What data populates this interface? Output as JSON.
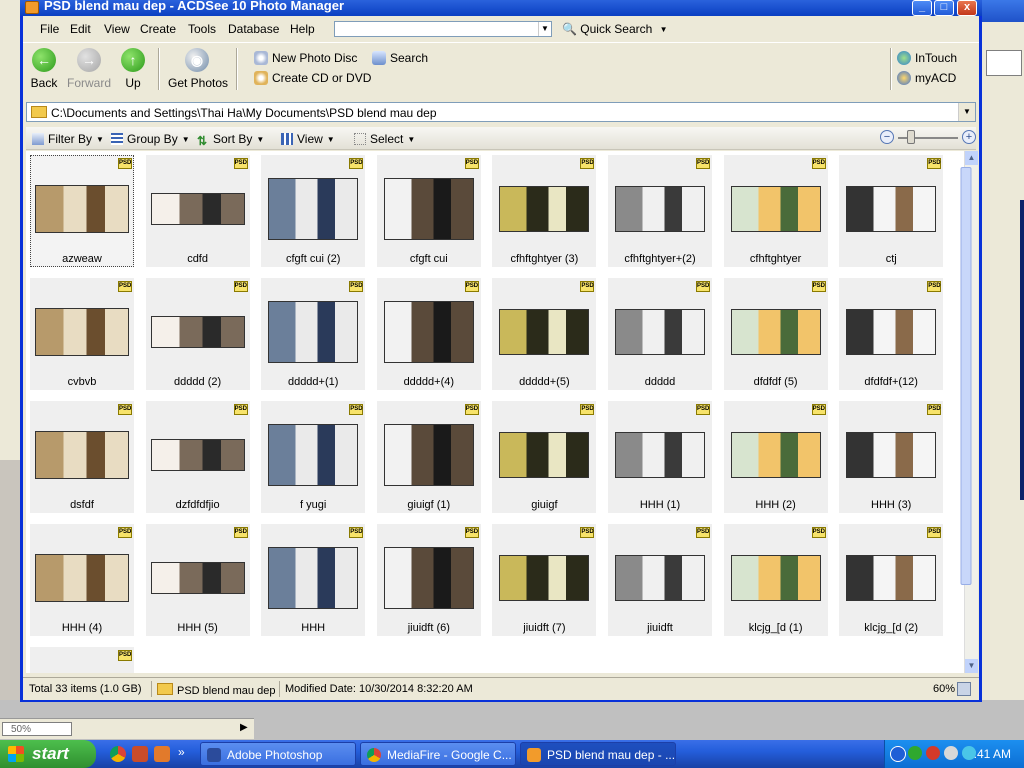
{
  "window": {
    "title": "PSD blend mau dep - ACDSee 10 Photo Manager",
    "min": "_",
    "max": "□",
    "close": "x"
  },
  "menu": [
    "File",
    "Edit",
    "View",
    "Create",
    "Tools",
    "Database",
    "Help"
  ],
  "quick_search": "Quick Search",
  "toolbar": {
    "back": "Back",
    "forward": "Forward",
    "up": "Up",
    "get_photos": "Get Photos",
    "new_photo_disc": "New Photo Disc",
    "create_cd": "Create CD or DVD",
    "search": "Search",
    "intouch": "InTouch",
    "myacd": "myACD"
  },
  "address_path": "C:\\Documents and Settings\\Thai Ha\\My Documents\\PSD blend mau dep",
  "filterbar": {
    "filter_by": "Filter By",
    "group_by": "Group By",
    "sort_by": "Sort By",
    "view": "View",
    "select": "Select"
  },
  "files": [
    {
      "name": "azweaw",
      "selected": true
    },
    {
      "name": "cdfd"
    },
    {
      "name": "cfgft cui (2)"
    },
    {
      "name": "cfgft cui"
    },
    {
      "name": "cfhftghtyer (3)"
    },
    {
      "name": "cfhftghtyer+(2)"
    },
    {
      "name": "cfhftghtyer"
    },
    {
      "name": "ctj"
    },
    {
      "name": "cvbvb"
    },
    {
      "name": "ddddd (2)"
    },
    {
      "name": "ddddd+(1)"
    },
    {
      "name": "ddddd+(4)"
    },
    {
      "name": "ddddd+(5)"
    },
    {
      "name": "ddddd"
    },
    {
      "name": "dfdfdf (5)"
    },
    {
      "name": "dfdfdf+(12)"
    },
    {
      "name": "dsfdf"
    },
    {
      "name": "dzfdfdfjio"
    },
    {
      "name": "f yugi"
    },
    {
      "name": "giuigf (1)"
    },
    {
      "name": "giuigf"
    },
    {
      "name": "HHH (1)"
    },
    {
      "name": "HHH (2)"
    },
    {
      "name": "HHH (3)"
    },
    {
      "name": "HHH (4)"
    },
    {
      "name": "HHH (5)"
    },
    {
      "name": "HHH"
    },
    {
      "name": "jiuidft (6)"
    },
    {
      "name": "jiuidft (7)"
    },
    {
      "name": "jiuidft"
    },
    {
      "name": "klcjg_[d (1)"
    },
    {
      "name": "klcjg_[d (2)"
    },
    {
      "name": ""
    }
  ],
  "psd_badge": "PSD",
  "status": {
    "total": "Total 33 items  (1.0 GB)",
    "folder": "PSD blend mau dep",
    "modified": "Modified Date: 10/30/2014 8:32:20 AM",
    "zoom": "60%"
  },
  "background_app": {
    "zoom_field": "50%"
  },
  "taskbar": {
    "start": "start",
    "tasks": [
      "Adobe Photoshop",
      "MediaFire - Google C...",
      "PSD blend mau dep - ..."
    ],
    "clock": "8:41 AM"
  }
}
